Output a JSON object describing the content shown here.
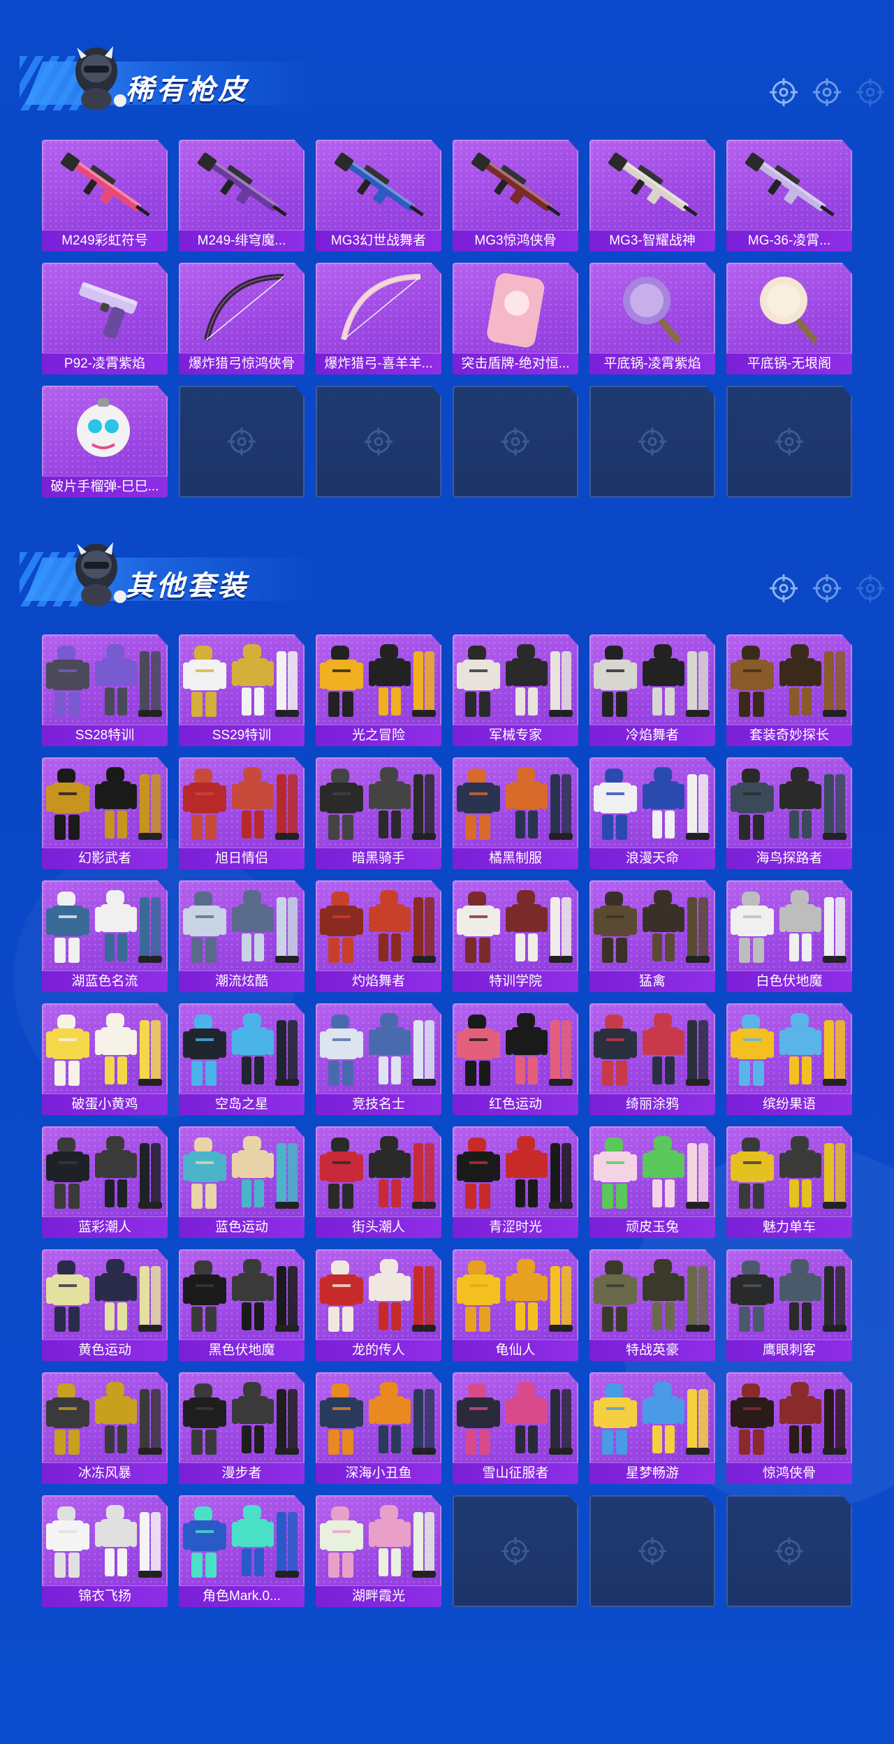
{
  "sections": [
    {
      "title": "稀有枪皮",
      "items": [
        {
          "name": "M249彩虹符号",
          "kind": "gun",
          "color": "#e8497b"
        },
        {
          "name": "M249-绯穹魔...",
          "kind": "gun",
          "color": "#6a3aa0"
        },
        {
          "name": "MG3幻世战舞者",
          "kind": "gun",
          "color": "#2f5ac2"
        },
        {
          "name": "MG3惊鸿侠骨",
          "kind": "gun",
          "color": "#7a2a2a"
        },
        {
          "name": "MG3-智耀战神",
          "kind": "gun",
          "color": "#d9d3c9"
        },
        {
          "name": "MG-36-凌霄...",
          "kind": "gun",
          "color": "#c6b6e6"
        },
        {
          "name": "P92-凌霄紫焰",
          "kind": "pistol",
          "color": "#d4c4f2"
        },
        {
          "name": "爆炸猎弓惊鸿侠骨",
          "kind": "bow",
          "color": "#3a2040"
        },
        {
          "name": "爆炸猎弓-喜羊羊...",
          "kind": "bow",
          "color": "#f0d0d8"
        },
        {
          "name": "突击盾牌-绝对恒...",
          "kind": "shield",
          "color": "#f4b8c8"
        },
        {
          "name": "平底锅-凌霄紫焰",
          "kind": "pan",
          "color": "#a884e0"
        },
        {
          "name": "平底锅-无垠阁",
          "kind": "pan",
          "color": "#f4e6d2"
        },
        {
          "name": "破片手榴弹-巳巳...",
          "kind": "grenade",
          "color": "#f2f2f2"
        }
      ],
      "empty_slots": 5
    },
    {
      "title": "其他套装",
      "items": [
        {
          "name": "SS28特训",
          "color": "#4a4a5a",
          "accent": "#7a5ad0"
        },
        {
          "name": "SS29特训",
          "color": "#f2f2f2",
          "accent": "#d4b03a"
        },
        {
          "name": "光之冒险",
          "color": "#f0b020",
          "accent": "#222222"
        },
        {
          "name": "军械专家",
          "color": "#e8e4dc",
          "accent": "#2a2a2a"
        },
        {
          "name": "冷焰舞者",
          "color": "#d8d6d0",
          "accent": "#222222"
        },
        {
          "name": "套装奇妙探长",
          "color": "#8a5a2a",
          "accent": "#3a2a1a"
        },
        {
          "name": "幻影武者",
          "color": "#c89420",
          "accent": "#1a1a1a"
        },
        {
          "name": "旭日情侣",
          "color": "#b82a2a",
          "accent": "#c84a3a"
        },
        {
          "name": "暗黑骑手",
          "color": "#2a2a2a",
          "accent": "#444444"
        },
        {
          "name": "橘黑制服",
          "color": "#2a3450",
          "accent": "#d86a2a"
        },
        {
          "name": "浪漫天命",
          "color": "#f0f0f0",
          "accent": "#2a4ab0"
        },
        {
          "name": "海鸟探路者",
          "color": "#3a4a5a",
          "accent": "#2a2a2a"
        },
        {
          "name": "湖蓝色名流",
          "color": "#3a6a98",
          "accent": "#f0f0f0"
        },
        {
          "name": "潮流炫酷",
          "color": "#c8d4e4",
          "accent": "#5a6a8a"
        },
        {
          "name": "灼焰舞者",
          "color": "#8a2a20",
          "accent": "#c8402a"
        },
        {
          "name": "特训学院",
          "color": "#f0ece8",
          "accent": "#7a2a2a"
        },
        {
          "name": "猛禽",
          "color": "#5a4a34",
          "accent": "#3a3028"
        },
        {
          "name": "白色伏地魔",
          "color": "#f0f0f0",
          "accent": "#bdbdbd"
        },
        {
          "name": "破蛋小黄鸡",
          "color": "#f4d84a",
          "accent": "#f6f2e8"
        },
        {
          "name": "空岛之星",
          "color": "#202630",
          "accent": "#4ab4e8"
        },
        {
          "name": "竞技名士",
          "color": "#dce4f0",
          "accent": "#4a6ab0"
        },
        {
          "name": "红色运动",
          "color": "#e4607a",
          "accent": "#1a1a1a"
        },
        {
          "name": "绮丽涂鸦",
          "color": "#2a3040",
          "accent": "#c83a4a"
        },
        {
          "name": "缤纷果语",
          "color": "#f4c020",
          "accent": "#5ab4e8"
        },
        {
          "name": "蓝彩潮人",
          "color": "#1e2228",
          "accent": "#3a3a3a"
        },
        {
          "name": "蓝色运动",
          "color": "#4ab4c8",
          "accent": "#e8d4a8"
        },
        {
          "name": "街头潮人",
          "color": "#c82a3a",
          "accent": "#2a2a2a"
        },
        {
          "name": "青涩时光",
          "color": "#1a1a1a",
          "accent": "#c82a2a"
        },
        {
          "name": "顽皮玉兔",
          "color": "#f4d4e4",
          "accent": "#5ac85a"
        },
        {
          "name": "魅力单车",
          "color": "#e4c020",
          "accent": "#3a3a3a"
        },
        {
          "name": "黄色运动",
          "color": "#e4e0a0",
          "accent": "#2a2a4a"
        },
        {
          "name": "黑色伏地魔",
          "color": "#1a1a1a",
          "accent": "#3a3a3a"
        },
        {
          "name": "龙的传人",
          "color": "#c82a2a",
          "accent": "#f0e8e0"
        },
        {
          "name": "龟仙人",
          "color": "#f4c020",
          "accent": "#e8a020"
        },
        {
          "name": "特战英豪",
          "color": "#6a6a4a",
          "accent": "#3a3a2a"
        },
        {
          "name": "鹰眼刺客",
          "color": "#2a2a2a",
          "accent": "#4a5a6a"
        },
        {
          "name": "冰冻风暴",
          "color": "#3a3a3a",
          "accent": "#c8a020"
        },
        {
          "name": "漫步者",
          "color": "#1e1e1e",
          "accent": "#3a3a3a"
        },
        {
          "name": "深海小丑鱼",
          "color": "#2a3a5a",
          "accent": "#e88a20"
        },
        {
          "name": "雪山征服者",
          "color": "#2a2a3a",
          "accent": "#d84a8a"
        },
        {
          "name": "星梦畅游",
          "color": "#f4d040",
          "accent": "#4a9ae8"
        },
        {
          "name": "惊鸿侠骨",
          "color": "#2a1a1a",
          "accent": "#8a2a2a"
        },
        {
          "name": "锦衣飞扬",
          "color": "#f4f4f4",
          "accent": "#e0e0e0"
        },
        {
          "name": "角色Mark.0...",
          "color": "#2a5ac8",
          "accent": "#4ae0c8"
        },
        {
          "name": "湖畔霞光",
          "color": "#e8f0e0",
          "accent": "#e8a0c8"
        }
      ],
      "empty_slots": 3
    }
  ]
}
